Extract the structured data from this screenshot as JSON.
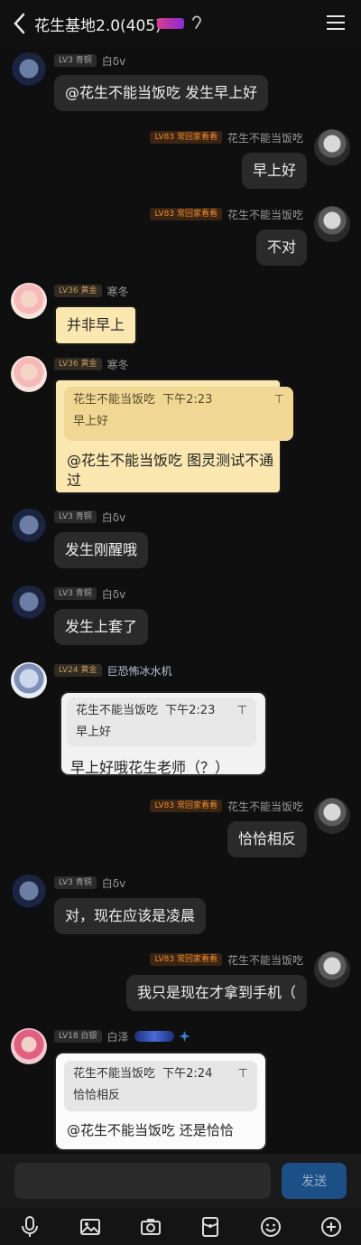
{
  "header": {
    "title": "花生基地2.0(405)"
  },
  "messages": {
    "m1": {
      "level": "LV3 青铜",
      "nick": "白δv",
      "text": "@花生不能当饭吃 发生早上好"
    },
    "m2": {
      "level": "LV83 常回家看看",
      "nick": "花生不能当饭吃",
      "text": "早上好"
    },
    "m3": {
      "level": "LV83 常回家看看",
      "nick": "花生不能当饭吃",
      "text": "不对"
    },
    "m4": {
      "level": "LV36 黄金",
      "nick": "寒冬",
      "text": "并非早上"
    },
    "m5": {
      "level": "LV36 黄金",
      "nick": "寒冬",
      "quote_author": "花生不能当饭吃",
      "quote_time": "下午2:23",
      "quote_text": "早上好",
      "text_line1": "@花生不能当饭吃 图灵测试不通",
      "text_line2": "过"
    },
    "m6": {
      "level": "LV3 青铜",
      "nick": "白δv",
      "text": "发生刚醒哦"
    },
    "m7": {
      "level": "LV3 青铜",
      "nick": "白δv",
      "text": "发生上套了"
    },
    "m8": {
      "level": "LV24 黄金",
      "nick": "巨恐怖冰水机",
      "quote_author": "花生不能当饭吃",
      "quote_time": "下午2:23",
      "quote_text": "早上好",
      "text": "早上好哦花生老师（？）"
    },
    "m9": {
      "level": "LV83 常回家看看",
      "nick": "花生不能当饭吃",
      "text": "恰恰相反"
    },
    "m10": {
      "level": "LV3 青铜",
      "nick": "白δv",
      "text": "对，现在应该是凌晨"
    },
    "m11": {
      "level": "LV83 常回家看看",
      "nick": "花生不能当饭吃",
      "text": "我只是现在才拿到手机（"
    },
    "m12": {
      "level": "LV18 白银",
      "nick": "白泽",
      "quote_author": "花生不能当饭吃",
      "quote_time": "下午2:24",
      "quote_text": "恰恰相反",
      "text": "@花生不能当饭吃 还是恰恰"
    }
  },
  "quote_arrow": "⊤",
  "input": {
    "send_label": "发送"
  },
  "icons": {
    "back": "chevron-left-icon",
    "menu": "menu-icon",
    "toolbar": [
      "microphone-icon",
      "image-icon",
      "camera-icon",
      "red-packet-icon",
      "emoji-icon",
      "plus-icon"
    ]
  }
}
